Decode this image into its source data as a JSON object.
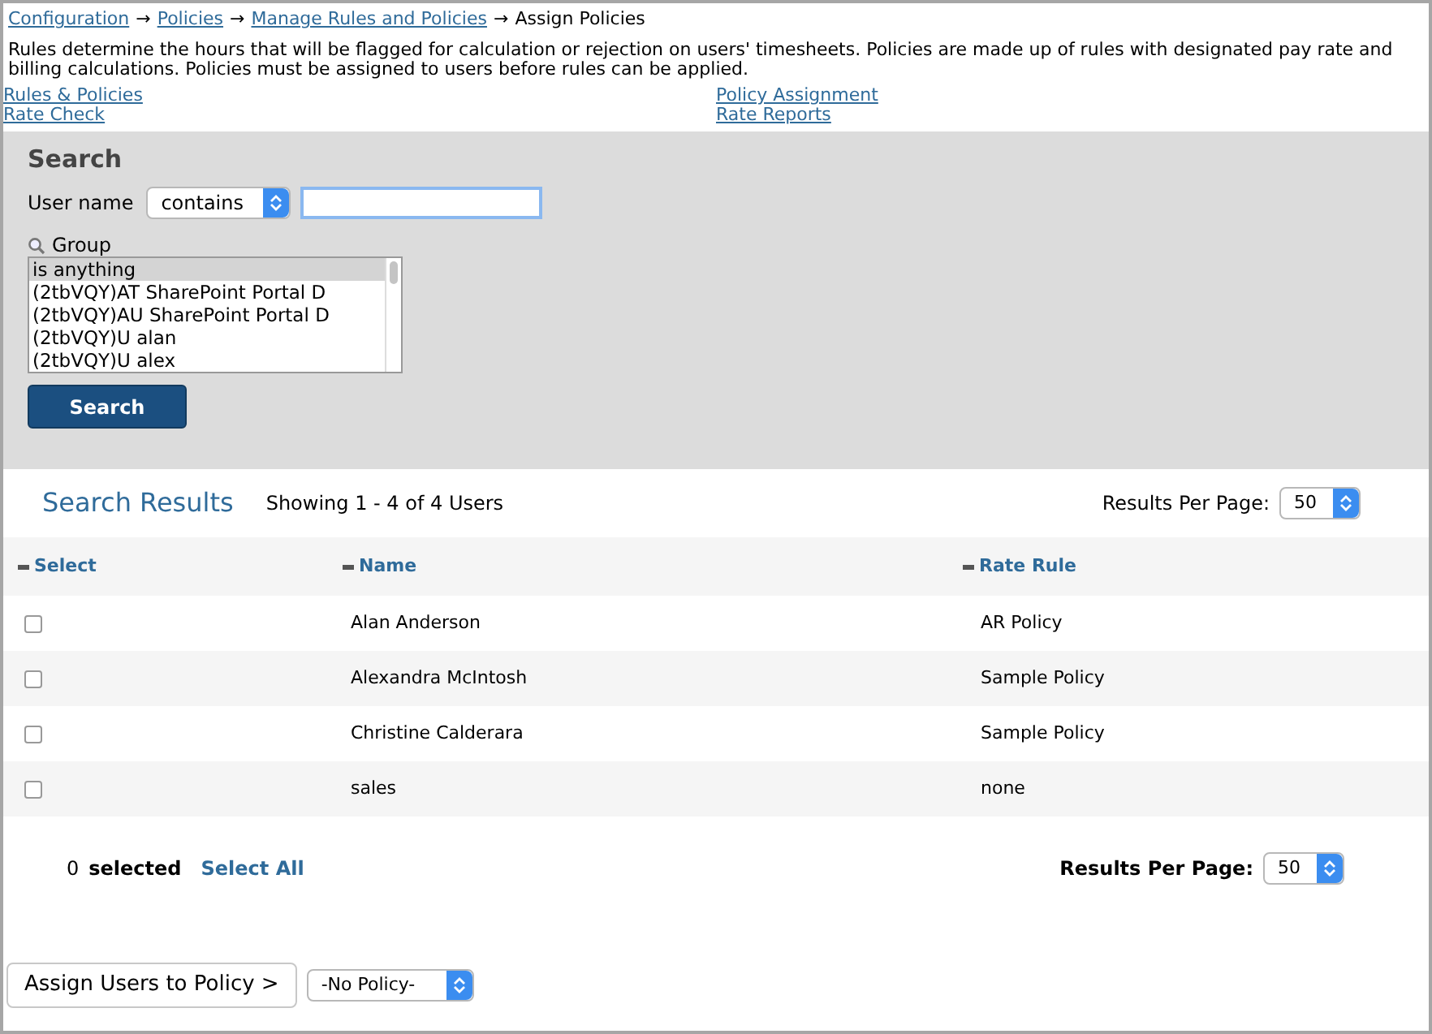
{
  "breadcrumb": {
    "separator": "→",
    "items": [
      {
        "label": "Configuration",
        "link": true
      },
      {
        "label": "Policies",
        "link": true
      },
      {
        "label": "Manage Rules and Policies",
        "link": true
      },
      {
        "label": "Assign Policies",
        "link": false
      }
    ]
  },
  "description": "Rules determine the hours that will be flagged for calculation or rejection on users' timesheets. Policies are made up of rules with designated pay rate and billing calculations. Policies must be assigned to users before rules can be applied.",
  "links": [
    [
      "Rules & Policies",
      "Rate Check"
    ],
    [
      "Policy Assignment",
      "Rate Reports"
    ]
  ],
  "search": {
    "title": "Search",
    "user_name_label": "User name",
    "match_select": "contains",
    "group_label": "Group",
    "group_options": [
      {
        "label": "is anything",
        "selected": true
      },
      {
        "label": "(2tbVQY)AT SharePoint Portal D",
        "selected": false
      },
      {
        "label": "(2tbVQY)AU SharePoint Portal D",
        "selected": false
      },
      {
        "label": "(2tbVQY)U alan",
        "selected": false
      },
      {
        "label": "(2tbVQY)U alex",
        "selected": false
      }
    ],
    "button": "Search"
  },
  "results": {
    "title": "Search Results",
    "showing": "Showing 1 - 4 of 4 Users",
    "per_page_label": "Results Per Page:",
    "per_page": "50",
    "columns": [
      "Select",
      "Name",
      "Rate Rule"
    ],
    "rows": [
      {
        "checked": false,
        "name": "Alan Anderson",
        "rate_rule": "AR Policy"
      },
      {
        "checked": false,
        "name": "Alexandra McIntosh",
        "rate_rule": "Sample Policy"
      },
      {
        "checked": false,
        "name": "Christine Calderara",
        "rate_rule": "Sample Policy"
      },
      {
        "checked": false,
        "name": "sales",
        "rate_rule": "none"
      }
    ]
  },
  "footer": {
    "selected_count": "0",
    "selected_label": "selected",
    "select_all": "Select All",
    "per_page_label": "Results Per Page:",
    "per_page": "50"
  },
  "assign": {
    "button": "Assign Users to Policy >",
    "policy_select": "-No Policy-"
  }
}
